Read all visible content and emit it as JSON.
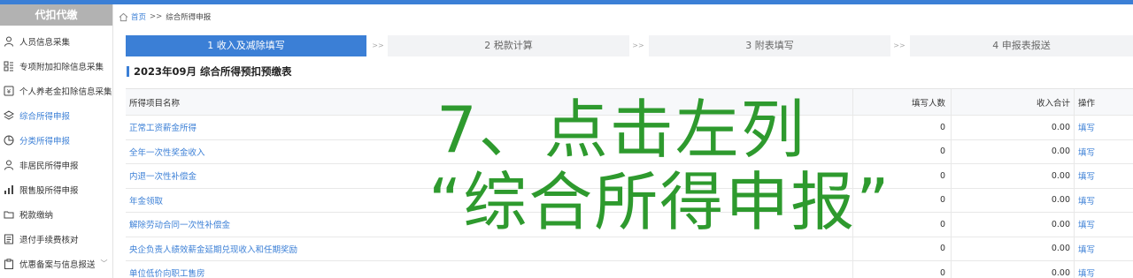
{
  "sidebar": {
    "header": "代扣代缴",
    "items": [
      {
        "label": "人员信息采集",
        "icon": "person-icon",
        "active": false
      },
      {
        "label": "专项附加扣除信息采集",
        "icon": "grid-list-icon",
        "active": false
      },
      {
        "label": "个人养老金扣除信息采集",
        "icon": "pension-icon",
        "active": false
      },
      {
        "label": "综合所得申报",
        "icon": "layers-icon",
        "active": true
      },
      {
        "label": "分类所得申报",
        "icon": "pie-icon",
        "active": true
      },
      {
        "label": "非居民所得申报",
        "icon": "user-outline-icon",
        "active": false
      },
      {
        "label": "限售股所得申报",
        "icon": "bar-chart-icon",
        "active": false
      },
      {
        "label": "税款缴纳",
        "icon": "folder-icon",
        "active": false
      },
      {
        "label": "退付手续费核对",
        "icon": "document-icon",
        "active": false
      },
      {
        "label": "优惠备案与信息报送",
        "icon": "clipboard-icon",
        "active": false,
        "chevron": "﹀"
      }
    ]
  },
  "breadcrumb": {
    "home": "首页",
    "sep": ">>",
    "current": "综合所得申报"
  },
  "steps": {
    "items": [
      "1 收入及减除填写",
      "2 税款计算",
      "3 附表填写",
      "4 申报表报送"
    ],
    "arrow": ">>"
  },
  "page_title": "2023年09月  综合所得预扣预缴表",
  "table": {
    "headers": {
      "name": "所得项目名称",
      "count": "填写人数",
      "income": "收入合计",
      "op": "操作"
    },
    "rows": [
      {
        "name": "正常工资薪金所得",
        "count": "0",
        "income": "0.00",
        "op": "填写"
      },
      {
        "name": "全年一次性奖金收入",
        "count": "0",
        "income": "0.00",
        "op": "填写"
      },
      {
        "name": "内退一次性补偿金",
        "count": "0",
        "income": "0.00",
        "op": "填写"
      },
      {
        "name": "年金领取",
        "count": "0",
        "income": "0.00",
        "op": "填写"
      },
      {
        "name": "解除劳动合同一次性补偿金",
        "count": "0",
        "income": "0.00",
        "op": "填写"
      },
      {
        "name": "央企负责人绩效薪金延期兑现收入和任期奖励",
        "count": "0",
        "income": "0.00",
        "op": "填写"
      },
      {
        "name": "单位低价向职工售房",
        "count": "0",
        "income": "0.00",
        "op": "填写"
      }
    ]
  },
  "annotation": {
    "line1": "7、点击左列",
    "line2": "“综合所得申报”"
  },
  "colors": {
    "accent": "#3b7fd6",
    "annotation": "#2e9a2e",
    "sidebar_header": "#b2b2b2"
  }
}
